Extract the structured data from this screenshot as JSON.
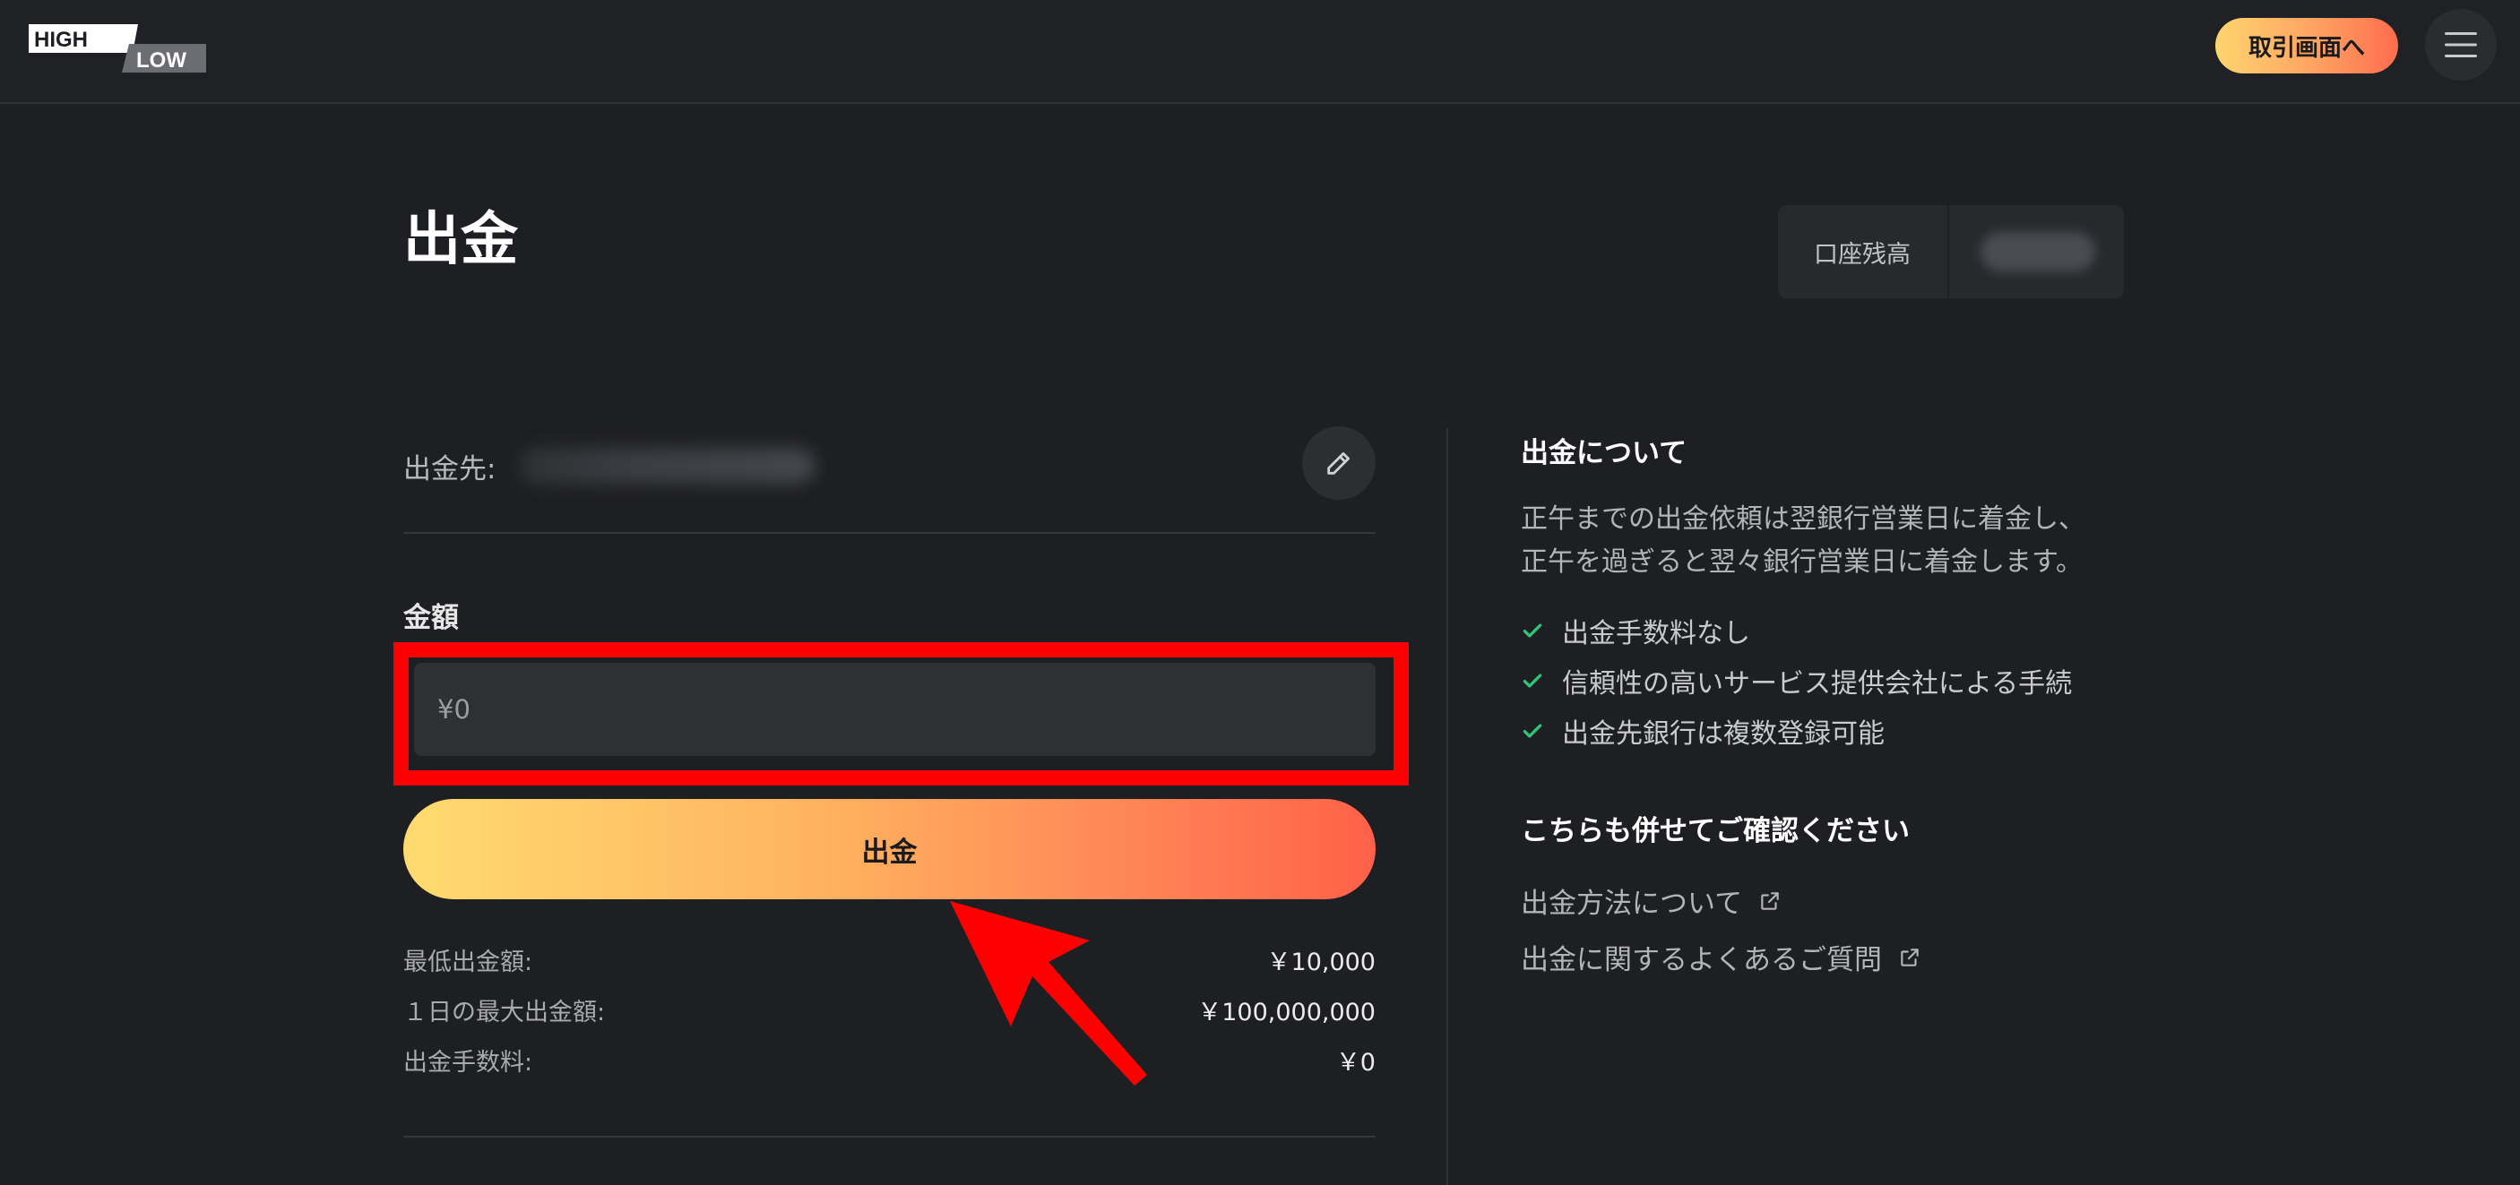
{
  "header": {
    "logo": {
      "top": "HIGH",
      "bottom": "LOW"
    },
    "trade_button": "取引画面へ",
    "menu_icon": "hamburger-menu-icon"
  },
  "page": {
    "title": "出金",
    "balance_label": "口座残高",
    "balance_value": "¥●●●●●"
  },
  "withdraw_form": {
    "destination_label": "出金先:",
    "edit_icon": "pencil-icon",
    "amount_label": "金額",
    "amount_placeholder": "¥0",
    "submit_label": "出金",
    "limits": [
      {
        "label": "最低出金額:",
        "value": "￥10,000"
      },
      {
        "label": "１日の最大出金額:",
        "value": "￥100,000,000"
      },
      {
        "label": "出金手数料:",
        "value": "￥0"
      }
    ]
  },
  "about": {
    "title": "出金について",
    "description_lines": [
      "正午までの出金依頼は翌銀行営業日に着金し、",
      "正午を過ぎると翌々銀行営業日に着金します。"
    ],
    "features": [
      "出金手数料なし",
      "信頼性の高いサービス提供会社による手続",
      "出金先銀行は複数登録可能"
    ],
    "check_color": "#2fc67a"
  },
  "confirm": {
    "title": "こちらも併せてご確認ください",
    "links": [
      "出金方法について",
      "出金に関するよくあるご質問"
    ],
    "link_icon": "external-link-icon"
  },
  "colors": {
    "background": "#1e1f22",
    "accent_start": "#ffdb6f",
    "accent_end": "#ff6148",
    "annotation_red": "#ff0000"
  }
}
